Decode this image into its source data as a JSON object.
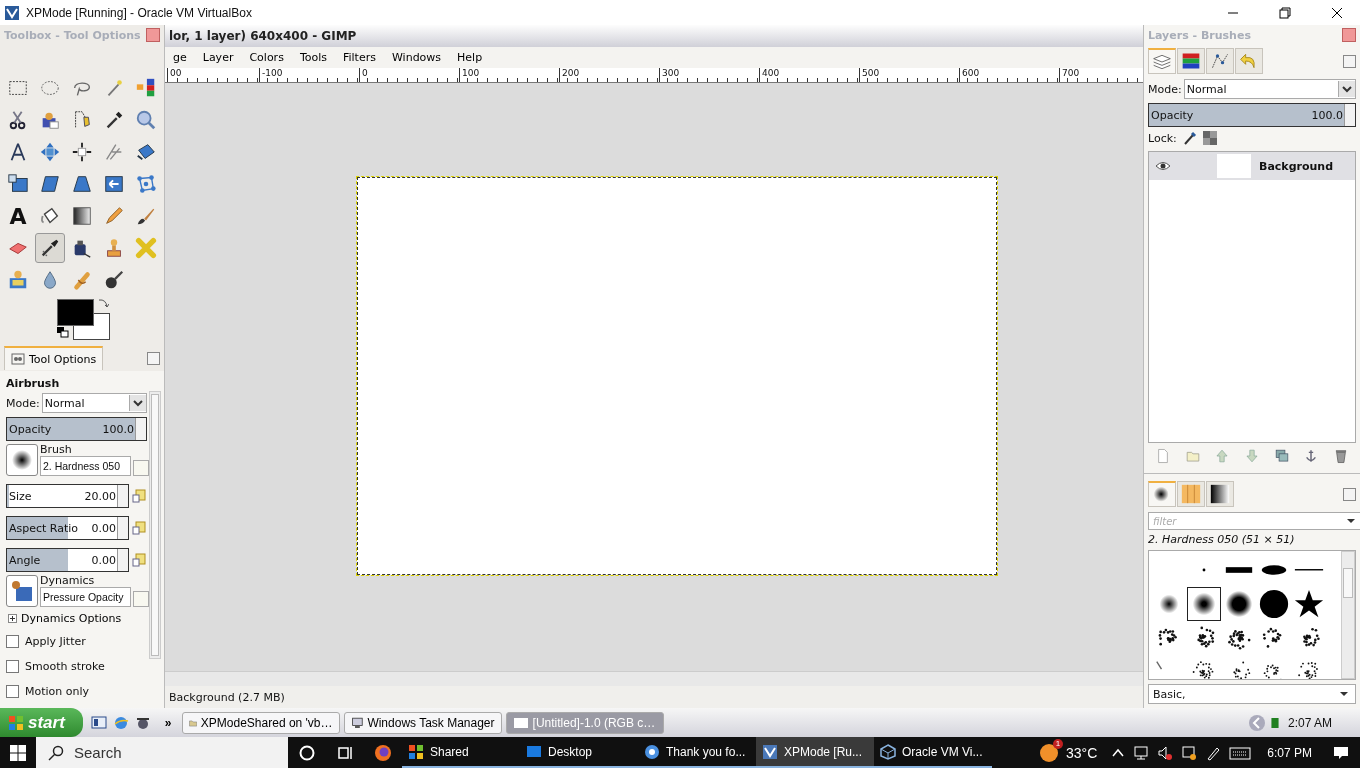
{
  "host_window": {
    "title": "XPMode [Running] - Oracle VM VirtualBox"
  },
  "toolbox": {
    "title": "Toolbox - Tool Options",
    "tools": [
      {
        "selected": false
      },
      {
        "selected": false
      },
      {
        "selected": false
      },
      {
        "selected": false
      },
      {
        "selected": false
      },
      {
        "selected": false
      },
      {
        "selected": false
      },
      {
        "selected": false
      },
      {
        "selected": false
      },
      {
        "selected": false
      },
      {
        "selected": false
      },
      {
        "selected": false
      },
      {
        "selected": false
      },
      {
        "selected": false
      },
      {
        "selected": false
      },
      {
        "selected": false
      },
      {
        "selected": false
      },
      {
        "selected": false
      },
      {
        "selected": false
      },
      {
        "selected": false
      },
      {
        "selected": false,
        "glyph": "A"
      },
      {
        "selected": false
      },
      {
        "selected": false
      },
      {
        "selected": false
      },
      {
        "selected": false
      },
      {
        "selected": false
      },
      {
        "selected": true
      },
      {
        "selected": false
      },
      {
        "selected": false
      },
      {
        "selected": false
      },
      {
        "selected": false
      },
      {
        "selected": false
      },
      {
        "selected": false
      },
      {
        "selected": false
      }
    ]
  },
  "tool_options": {
    "tab": "Tool Options",
    "tool": "Airbrush",
    "mode_label": "Mode:",
    "mode": "Normal",
    "opacity": {
      "label": "Opacity",
      "value": "100.0",
      "level": 1
    },
    "brush": {
      "label": "Brush",
      "value": "2. Hardness 050"
    },
    "sliders": [
      {
        "label": "Size",
        "value": "20.00",
        "level": 0.02
      },
      {
        "label": "Aspect Ratio",
        "value": "0.00",
        "level": 0.5
      },
      {
        "label": "Angle",
        "value": "0.00",
        "level": 0.5
      }
    ],
    "dynamics": {
      "label": "Dynamics",
      "value": "Pressure Opacity"
    },
    "dynamics_options": {
      "label": "Dynamics Options",
      "expanded": false
    },
    "checkboxes": [
      {
        "label": "Apply Jitter",
        "checked": false
      },
      {
        "label": "Smooth stroke",
        "checked": false
      },
      {
        "label": "Motion only",
        "checked": false
      }
    ]
  },
  "image_window": {
    "title": "lor, 1 layer) 640x400 - GIMP",
    "menu": [
      "ge",
      "Layer",
      "Colors",
      "Tools",
      "Filters",
      "Windows",
      "Help"
    ],
    "ruler": [
      "00",
      "-100",
      "0",
      "100",
      "200",
      "300",
      "400",
      "500",
      "600",
      "700"
    ],
    "status": "Background (2.7 MB)"
  },
  "layers_dock": {
    "title": "Layers - Brushes",
    "tabs": [
      {
        "selected": true
      },
      {
        "selected": false
      },
      {
        "selected": false
      },
      {
        "selected": false
      }
    ],
    "mode_label": "Mode:",
    "mode": "Normal",
    "opacity": {
      "label": "Opacity",
      "value": "100.0",
      "level": 1
    },
    "lock_label": "Lock:",
    "layers": [
      {
        "name": "Background",
        "selected": true,
        "visible": true
      }
    ]
  },
  "brushes_dock": {
    "tabs": [
      {
        "selected": true
      },
      {
        "selected": false
      },
      {
        "selected": false
      }
    ],
    "filter_placeholder": "filter",
    "brush_name": "2. Hardness 050 (51 × 51)",
    "brushes": [
      {
        "selected": false
      },
      {
        "selected": false
      },
      {
        "selected": false
      },
      {
        "selected": false
      },
      {
        "selected": false
      },
      {
        "selected": true
      },
      {
        "selected": false
      },
      {
        "selected": false
      },
      {
        "selected": false
      },
      {
        "selected": false
      },
      {
        "selected": false
      },
      {
        "selected": false
      },
      {
        "selected": false
      },
      {
        "selected": false
      },
      {
        "selected": false
      },
      {
        "selected": false
      },
      {
        "selected": false
      },
      {
        "selected": false
      },
      {
        "selected": false
      }
    ],
    "tag": "Basic,"
  },
  "xp_taskbar": {
    "start": "start",
    "overflow": "»",
    "tasks": [
      {
        "label": "XPModeShared on 'vb…",
        "selected": false
      },
      {
        "label": "Windows Task Manager",
        "selected": false
      },
      {
        "label": "[Untitled]-1.0 (RGB c…",
        "selected": true
      }
    ],
    "clock": "2:07 AM"
  },
  "win_taskbar": {
    "search": "Search",
    "apps": [
      {
        "label": "Shared",
        "selected": false
      },
      {
        "label": "Desktop",
        "selected": false
      },
      {
        "label": "Thank you fo...",
        "selected": false
      },
      {
        "label": "XPMode [Ru...",
        "selected": true
      },
      {
        "label": "Oracle VM Vi...",
        "selected": false
      }
    ],
    "weather": {
      "badge": "1",
      "temperature": "33°C"
    },
    "clock": "6:07 PM"
  }
}
